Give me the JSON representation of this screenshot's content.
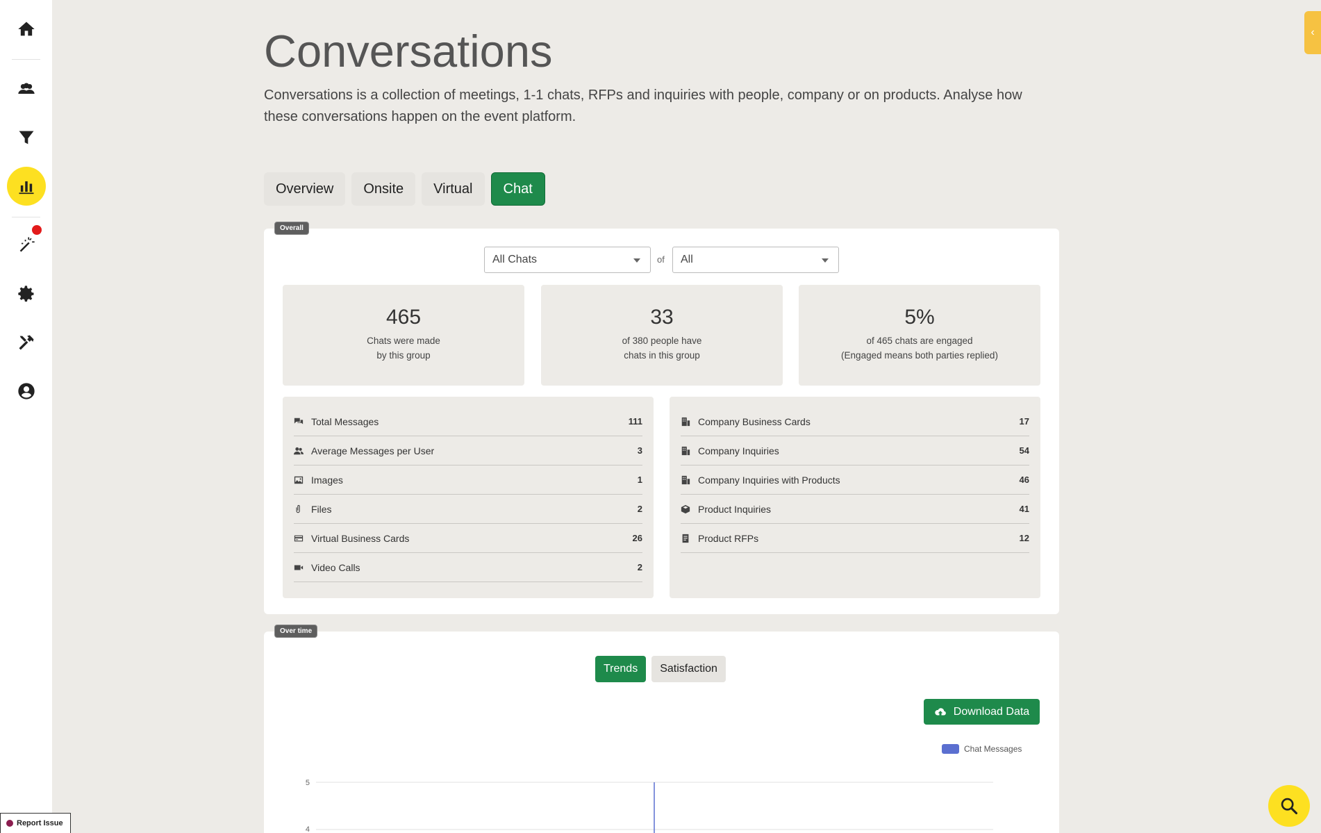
{
  "sidebar": {
    "items": [
      {
        "icon": "home-icon"
      },
      {
        "icon": "people-icon"
      },
      {
        "icon": "filter-icon"
      },
      {
        "icon": "bar-chart-icon",
        "active": true
      },
      {
        "icon": "magic-wand-icon",
        "notification": true
      },
      {
        "icon": "gear-icon"
      },
      {
        "icon": "tools-icon"
      },
      {
        "icon": "user-circle-icon"
      }
    ],
    "report_issue": "Report Issue"
  },
  "header": {
    "title": "Conversations",
    "description": "Conversations is a collection of meetings, 1-1 chats, RFPs and inquiries with people, company or on products. Analyse how these conversations happen on the event platform."
  },
  "tabs": [
    {
      "label": "Overview",
      "active": false
    },
    {
      "label": "Onsite",
      "active": false
    },
    {
      "label": "Virtual",
      "active": false
    },
    {
      "label": "Chat",
      "active": true
    }
  ],
  "overall": {
    "badge": "Overall",
    "filter_type": "All Chats",
    "of_label": "of",
    "filter_group": "All",
    "stats": [
      {
        "value": "465",
        "line1": "Chats were made",
        "line2": "by this group"
      },
      {
        "value": "33",
        "line1": "of 380 people have",
        "line2": "chats in this group"
      },
      {
        "value": "5%",
        "line1": "of 465 chats are engaged",
        "line2": "(Engaged means both parties replied)"
      }
    ],
    "left_list": [
      {
        "icon": "messages-icon",
        "label": "Total Messages",
        "value": "111"
      },
      {
        "icon": "users-icon",
        "label": "Average Messages per User",
        "value": "3"
      },
      {
        "icon": "image-icon",
        "label": "Images",
        "value": "1"
      },
      {
        "icon": "paperclip-icon",
        "label": "Files",
        "value": "2"
      },
      {
        "icon": "card-icon",
        "label": "Virtual Business Cards",
        "value": "26"
      },
      {
        "icon": "video-icon",
        "label": "Video Calls",
        "value": "2"
      }
    ],
    "right_list": [
      {
        "icon": "building-icon",
        "label": "Company Business Cards",
        "value": "17"
      },
      {
        "icon": "building-icon",
        "label": "Company Inquiries",
        "value": "54"
      },
      {
        "icon": "building-icon",
        "label": "Company Inquiries with Products",
        "value": "46"
      },
      {
        "icon": "box-icon",
        "label": "Product Inquiries",
        "value": "41"
      },
      {
        "icon": "document-icon",
        "label": "Product RFPs",
        "value": "12"
      }
    ]
  },
  "over_time": {
    "badge": "Over time",
    "subtabs": [
      {
        "label": "Trends",
        "active": true
      },
      {
        "label": "Satisfaction",
        "active": false
      }
    ],
    "download_label": "Download Data",
    "legend_label": "Chat Messages",
    "legend_color": "#5b6fd0",
    "y_ticks": [
      "5",
      "4"
    ]
  },
  "colors": {
    "accent_green": "#1e8a4b",
    "accent_yellow": "#fde021",
    "background": "#edebe7"
  }
}
